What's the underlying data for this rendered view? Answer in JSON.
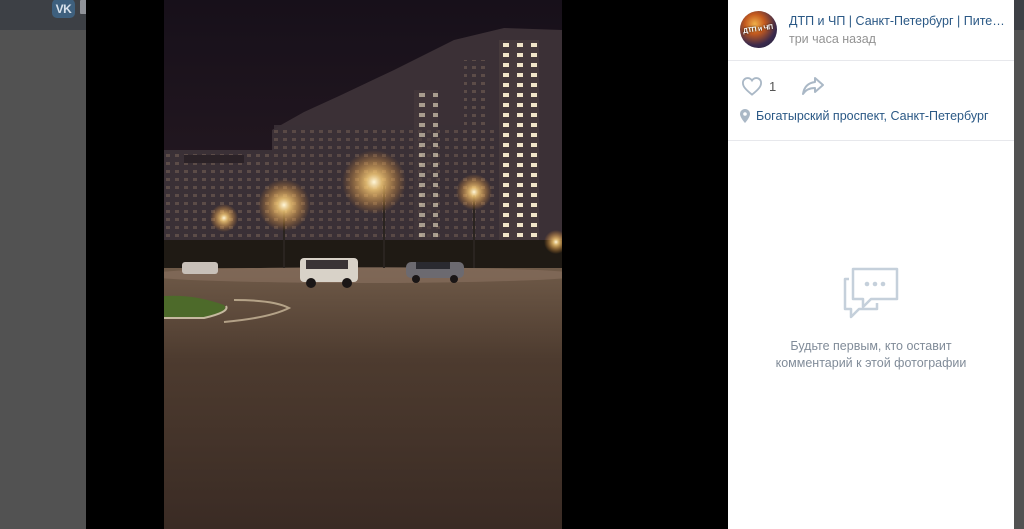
{
  "header": {
    "logo_text": "VK"
  },
  "post": {
    "group_name": "ДТП и ЧП | Санкт-Петербург | Питер Онлайн | СПб",
    "avatar_text": "ДТП и ЧП",
    "time": "три часа назад",
    "likes": "1",
    "location": "Богатырский проспект, Санкт-Петербург"
  },
  "comments": {
    "empty_line_1": "Будьте первым, кто оставит",
    "empty_line_2": "комментарий к этой фотографии"
  },
  "colors": {
    "link": "#2a5885",
    "muted": "#939393",
    "icon": "#aab8c6",
    "empty_icon": "#c5d0db"
  },
  "icons": [
    "vk-logo-icon",
    "heart-icon",
    "share-icon",
    "map-pin-icon",
    "comments-icon"
  ]
}
